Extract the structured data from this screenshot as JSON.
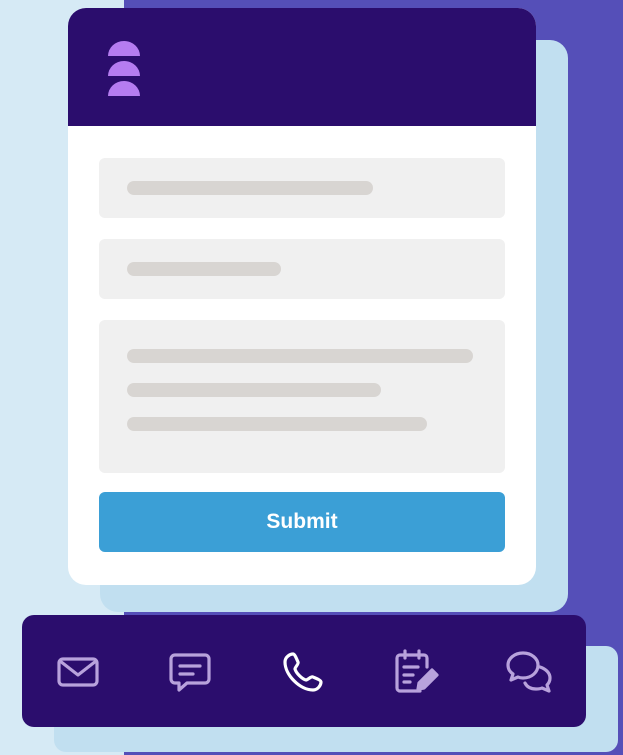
{
  "form": {
    "submit_label": "Submit"
  },
  "nav": {
    "items": [
      {
        "icon": "mail-icon"
      },
      {
        "icon": "chat-icon"
      },
      {
        "icon": "phone-icon"
      },
      {
        "icon": "form-edit-icon"
      },
      {
        "icon": "conversation-icon"
      }
    ]
  },
  "colors": {
    "header": "#2b0d6d",
    "accent": "#3b9fd6",
    "logo": "#b57cf0",
    "nav_icon": "#b8a2dc",
    "nav_icon_active": "#ffffff",
    "background_purple": "#554fb8",
    "background_light": "#d6eaf5"
  }
}
